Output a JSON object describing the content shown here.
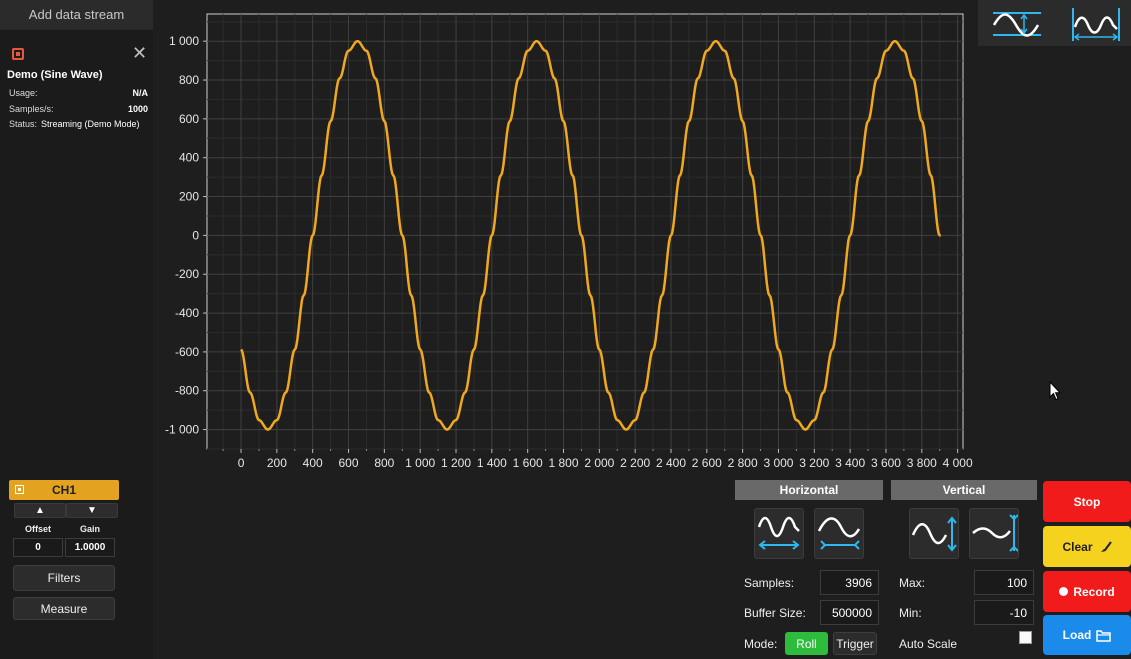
{
  "sidebar": {
    "add_stream_label": "Add data stream",
    "stream": {
      "name": "Demo (Sine Wave)",
      "close_icon": "close-icon",
      "status_icon": "stop-square-icon",
      "usage_label": "Usage:",
      "usage_value": "N/A",
      "samples_label": "Samples/s:",
      "samples_value": "1000",
      "status_label": "Status:",
      "status_value": "Streaming (Demo Mode)"
    },
    "channel": {
      "name": "CH1",
      "color": "#e3a321",
      "up_label": "▲",
      "down_label": "▼",
      "offset_label": "Offset",
      "gain_label": "Gain",
      "offset_value": "0",
      "gain_value": "1.0000"
    },
    "filters_label": "Filters",
    "measure_label": "Measure"
  },
  "chart_data": {
    "type": "line",
    "title": "",
    "xlabel": "",
    "ylabel": "",
    "xlim": [
      -190,
      4030
    ],
    "ylim": [
      -1100,
      1140
    ],
    "xticks": [
      0,
      200,
      400,
      600,
      800,
      1000,
      1200,
      1400,
      1600,
      1800,
      2000,
      2200,
      2400,
      2600,
      2800,
      3000,
      3200,
      3400,
      3600,
      3800,
      4000
    ],
    "xtick_labels": [
      "0",
      "200",
      "400",
      "600",
      "800",
      "1 000",
      "1 200",
      "1 400",
      "1 600",
      "1 800",
      "2 000",
      "2 200",
      "2 400",
      "2 600",
      "2 800",
      "3 000",
      "3 200",
      "3 400",
      "3 600",
      "3 800",
      "4 000"
    ],
    "yticks": [
      1000,
      800,
      600,
      400,
      200,
      0,
      -200,
      -400,
      -600,
      -800,
      -1000
    ],
    "ytick_labels": [
      "1 000",
      "800",
      "600",
      "400",
      "200",
      "0",
      "-200",
      "-400",
      "-600",
      "-800",
      "-1 000"
    ],
    "grid": true,
    "series": [
      {
        "color": "#f0a81e",
        "x": [
          0,
          50,
          100,
          150,
          200,
          250,
          300,
          350,
          400,
          450,
          500,
          550,
          600,
          650,
          700,
          750,
          800,
          850,
          900,
          950,
          1000,
          1050,
          1100,
          1150,
          1200,
          1250,
          1300,
          1350,
          1400,
          1450,
          1500,
          1550,
          1600,
          1650,
          1700,
          1750,
          1800,
          1850,
          1900,
          1950,
          2000,
          2050,
          2100,
          2150,
          2200,
          2250,
          2300,
          2350,
          2400,
          2450,
          2500,
          2550,
          2600,
          2650,
          2700,
          2750,
          2800,
          2850,
          2900,
          2950,
          3000,
          3050,
          3100,
          3150,
          3200,
          3250,
          3300,
          3350,
          3400,
          3450,
          3500,
          3550,
          3600,
          3650,
          3700,
          3750,
          3800,
          3850,
          3900,
          3906
        ],
        "y": [
          -588,
          -809,
          -951,
          -1000,
          -951,
          -809,
          -588,
          -309,
          0,
          309,
          588,
          809,
          951,
          1000,
          951,
          809,
          588,
          309,
          0,
          -309,
          -588,
          -809,
          -951,
          -1000,
          -951,
          -809,
          -588,
          -309,
          0,
          309,
          588,
          809,
          951,
          1000,
          951,
          809,
          588,
          309,
          0,
          -309,
          -588,
          -809,
          -951,
          -1000,
          -951,
          -809,
          -588,
          -309,
          0,
          309,
          588,
          809,
          951,
          1000,
          951,
          809,
          588,
          309,
          0,
          -309,
          -588,
          -809,
          -951,
          -1000,
          -951,
          -809,
          -588,
          -309,
          0,
          309,
          588,
          809,
          951,
          1000,
          951,
          809,
          588,
          309,
          0,
          0
        ]
      }
    ]
  },
  "toolbar_right": {
    "autoscale_vertical_icon": "vertical-autoscale-icon",
    "autoscale_horizontal_icon": "horizontal-autoscale-icon"
  },
  "horizontal": {
    "header": "Horizontal",
    "expand_icon": "horizontal-expand-icon",
    "compress_icon": "horizontal-compress-icon",
    "samples_label": "Samples:",
    "samples_value": "3906",
    "buffer_label": "Buffer Size:",
    "buffer_value": "500000",
    "mode_label": "Mode:",
    "mode_roll": "Roll",
    "mode_trigger": "Trigger"
  },
  "vertical": {
    "header": "Vertical",
    "expand_icon": "vertical-expand-icon",
    "compress_icon": "vertical-compress-icon",
    "max_label": "Max:",
    "max_value": "100",
    "min_label": "Min:",
    "min_value": "-10",
    "autoscale_label": "Auto Scale",
    "autoscale_checked": false
  },
  "actions": {
    "stop_label": "Stop",
    "stop_color": "#f21b1b",
    "clear_label": "Clear",
    "clear_color": "#f5d21e",
    "record_label": "Record",
    "record_color": "#f21b1b",
    "load_label": "Load",
    "load_color": "#1a8bea"
  }
}
